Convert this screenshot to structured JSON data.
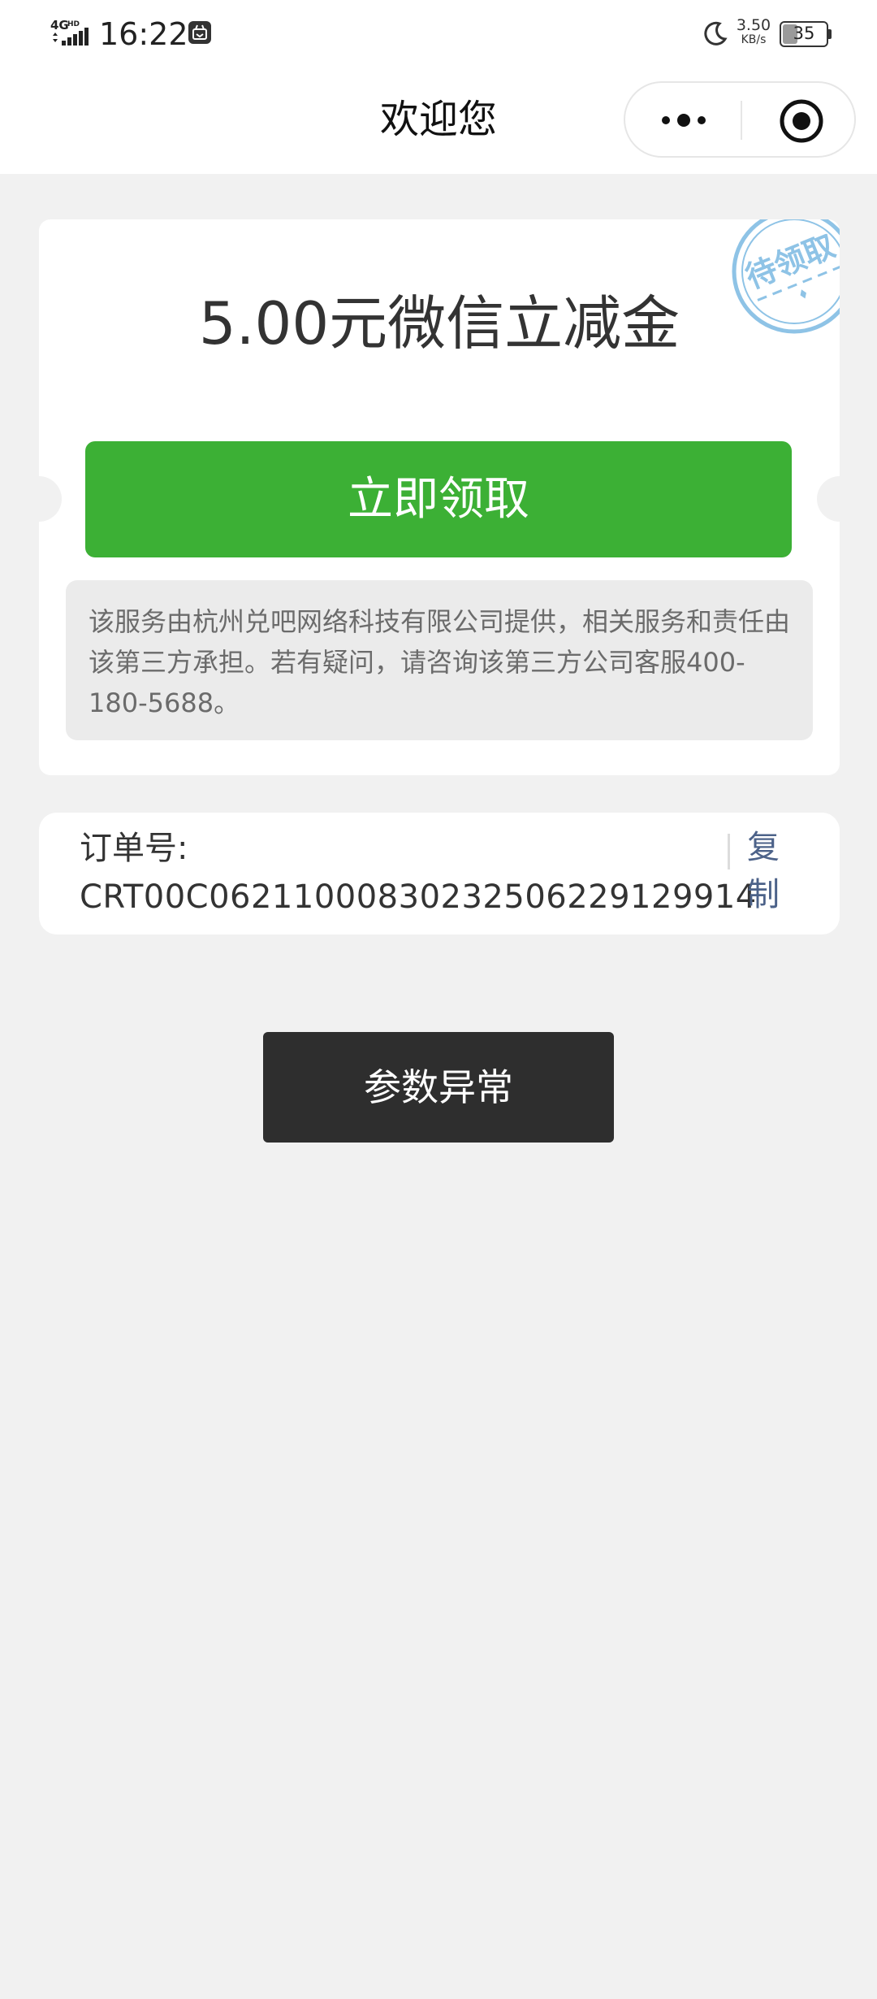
{
  "status_bar": {
    "network": "4G HD",
    "time": "16:22",
    "net_speed_value": "3.50",
    "net_speed_unit": "KB/s",
    "battery_level": "35"
  },
  "nav": {
    "title": "欢迎您",
    "icons": [
      "more-dots-icon",
      "close-target-icon"
    ]
  },
  "coupon": {
    "stamp_text": "待领取",
    "title": "5.00元微信立减金",
    "claim_label": "立即领取",
    "notice": "该服务由杭州兑吧网络科技有限公司提供，相关服务和责任由该第三方承担。若有疑问，请咨询该第三方公司客服400-180-5688。"
  },
  "order": {
    "label": "订单号:",
    "number": "CRT00C062110008302325062291299 14",
    "copy_label": "复制"
  },
  "error": {
    "label": "参数异常"
  },
  "colors": {
    "accent_green": "#3cb035",
    "stamp_blue": "#8ec3e6",
    "link_blue": "#4c6289",
    "dark_button": "#2e2e2e",
    "page_background": "#f1f1f1"
  }
}
